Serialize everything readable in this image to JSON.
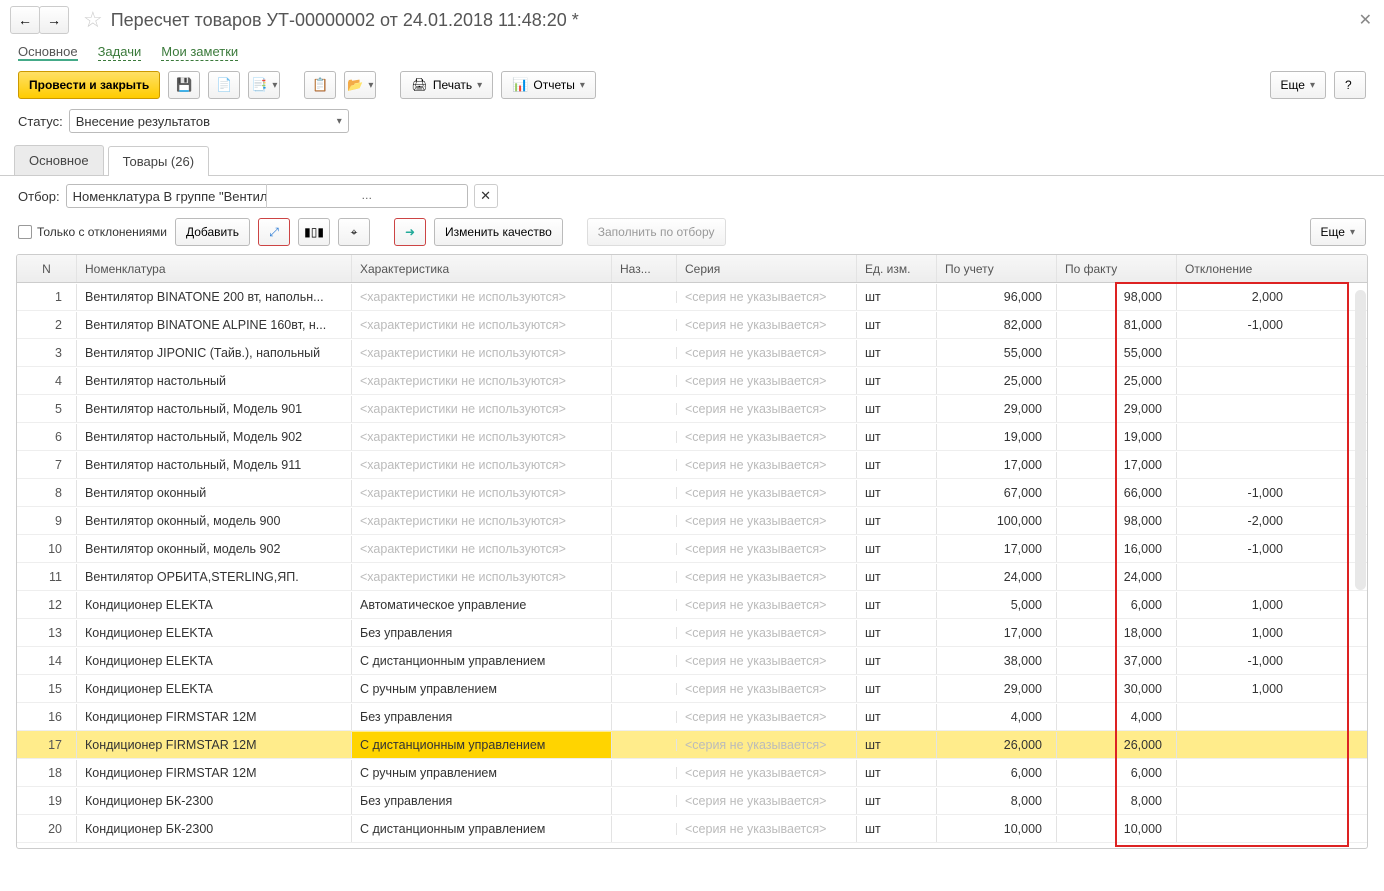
{
  "title": "Пересчет товаров УТ-00000002 от 24.01.2018 11:48:20 *",
  "topTabs": {
    "main": "Основное",
    "tasks": "Задачи",
    "notes": "Мои заметки"
  },
  "toolbar": {
    "postClose": "Провести и закрыть",
    "print": "Печать",
    "reports": "Отчеты",
    "more": "Еще",
    "help": "?"
  },
  "status": {
    "label": "Статус:",
    "value": "Внесение результатов"
  },
  "innerTabs": {
    "main": "Основное",
    "goods": "Товары (26)"
  },
  "filter": {
    "label": "Отбор:",
    "value": "Номенклатура В группе \"Вентиляторы, пылесосы, кондицио"
  },
  "actions": {
    "onlyDev": "Только с отклонениями",
    "add": "Добавить",
    "changeQuality": "Изменить качество",
    "fillByFilter": "Заполнить по отбору",
    "more": "Еще"
  },
  "columns": {
    "n": "N",
    "name": "Номенклатура",
    "char": "Характеристика",
    "alt": "Наз...",
    "series": "Серия",
    "unit": "Ед. изм.",
    "acc": "По учету",
    "fact": "По факту",
    "dev": "Отклонение"
  },
  "placeholders": {
    "char": "<характеристики не используются>",
    "series": "<серия не указывается>"
  },
  "unit": "шт",
  "rows": [
    {
      "n": "1",
      "name": "Вентилятор BINATONE 200 вт, напольн...",
      "char": "",
      "acc": "96,000",
      "fact": "98,000",
      "dev": "2,000"
    },
    {
      "n": "2",
      "name": "Вентилятор BINATONE ALPINE 160вт, н...",
      "char": "",
      "acc": "82,000",
      "fact": "81,000",
      "dev": "-1,000"
    },
    {
      "n": "3",
      "name": "Вентилятор JIPONIC (Тайв.), напольный",
      "char": "",
      "acc": "55,000",
      "fact": "55,000",
      "dev": ""
    },
    {
      "n": "4",
      "name": "Вентилятор настольный",
      "char": "",
      "acc": "25,000",
      "fact": "25,000",
      "dev": ""
    },
    {
      "n": "5",
      "name": "Вентилятор настольный, Модель 901",
      "char": "",
      "acc": "29,000",
      "fact": "29,000",
      "dev": ""
    },
    {
      "n": "6",
      "name": "Вентилятор настольный, Модель 902",
      "char": "",
      "acc": "19,000",
      "fact": "19,000",
      "dev": ""
    },
    {
      "n": "7",
      "name": "Вентилятор настольный, Модель 911",
      "char": "",
      "acc": "17,000",
      "fact": "17,000",
      "dev": ""
    },
    {
      "n": "8",
      "name": "Вентилятор оконный",
      "char": "",
      "acc": "67,000",
      "fact": "66,000",
      "dev": "-1,000"
    },
    {
      "n": "9",
      "name": "Вентилятор оконный, модель 900",
      "char": "",
      "acc": "100,000",
      "fact": "98,000",
      "dev": "-2,000"
    },
    {
      "n": "10",
      "name": "Вентилятор оконный, модель 902",
      "char": "",
      "acc": "17,000",
      "fact": "16,000",
      "dev": "-1,000"
    },
    {
      "n": "11",
      "name": "Вентилятор ОРБИТА,STERLING,ЯП.",
      "char": "",
      "acc": "24,000",
      "fact": "24,000",
      "dev": ""
    },
    {
      "n": "12",
      "name": "Кондиционер ELEKTA",
      "char": "Автоматическое управление",
      "acc": "5,000",
      "fact": "6,000",
      "dev": "1,000"
    },
    {
      "n": "13",
      "name": "Кондиционер ELEKTA",
      "char": "Без управления",
      "acc": "17,000",
      "fact": "18,000",
      "dev": "1,000"
    },
    {
      "n": "14",
      "name": "Кондиционер ELEKTA",
      "char": "С дистанционным управлением",
      "acc": "38,000",
      "fact": "37,000",
      "dev": "-1,000"
    },
    {
      "n": "15",
      "name": "Кондиционер ELEKTA",
      "char": "С ручным управлением",
      "acc": "29,000",
      "fact": "30,000",
      "dev": "1,000"
    },
    {
      "n": "16",
      "name": "Кондиционер FIRMSTAR 12M",
      "char": "Без управления",
      "acc": "4,000",
      "fact": "4,000",
      "dev": ""
    },
    {
      "n": "17",
      "name": "Кондиционер FIRMSTAR 12M",
      "char": "С дистанционным управлением",
      "acc": "26,000",
      "fact": "26,000",
      "dev": "",
      "sel": true
    },
    {
      "n": "18",
      "name": "Кондиционер FIRMSTAR 12M",
      "char": "С ручным управлением",
      "acc": "6,000",
      "fact": "6,000",
      "dev": ""
    },
    {
      "n": "19",
      "name": "Кондиционер БК-2300",
      "char": "Без управления",
      "acc": "8,000",
      "fact": "8,000",
      "dev": ""
    },
    {
      "n": "20",
      "name": "Кондиционер БК-2300",
      "char": "С дистанционным управлением",
      "acc": "10,000",
      "fact": "10,000",
      "dev": ""
    }
  ]
}
